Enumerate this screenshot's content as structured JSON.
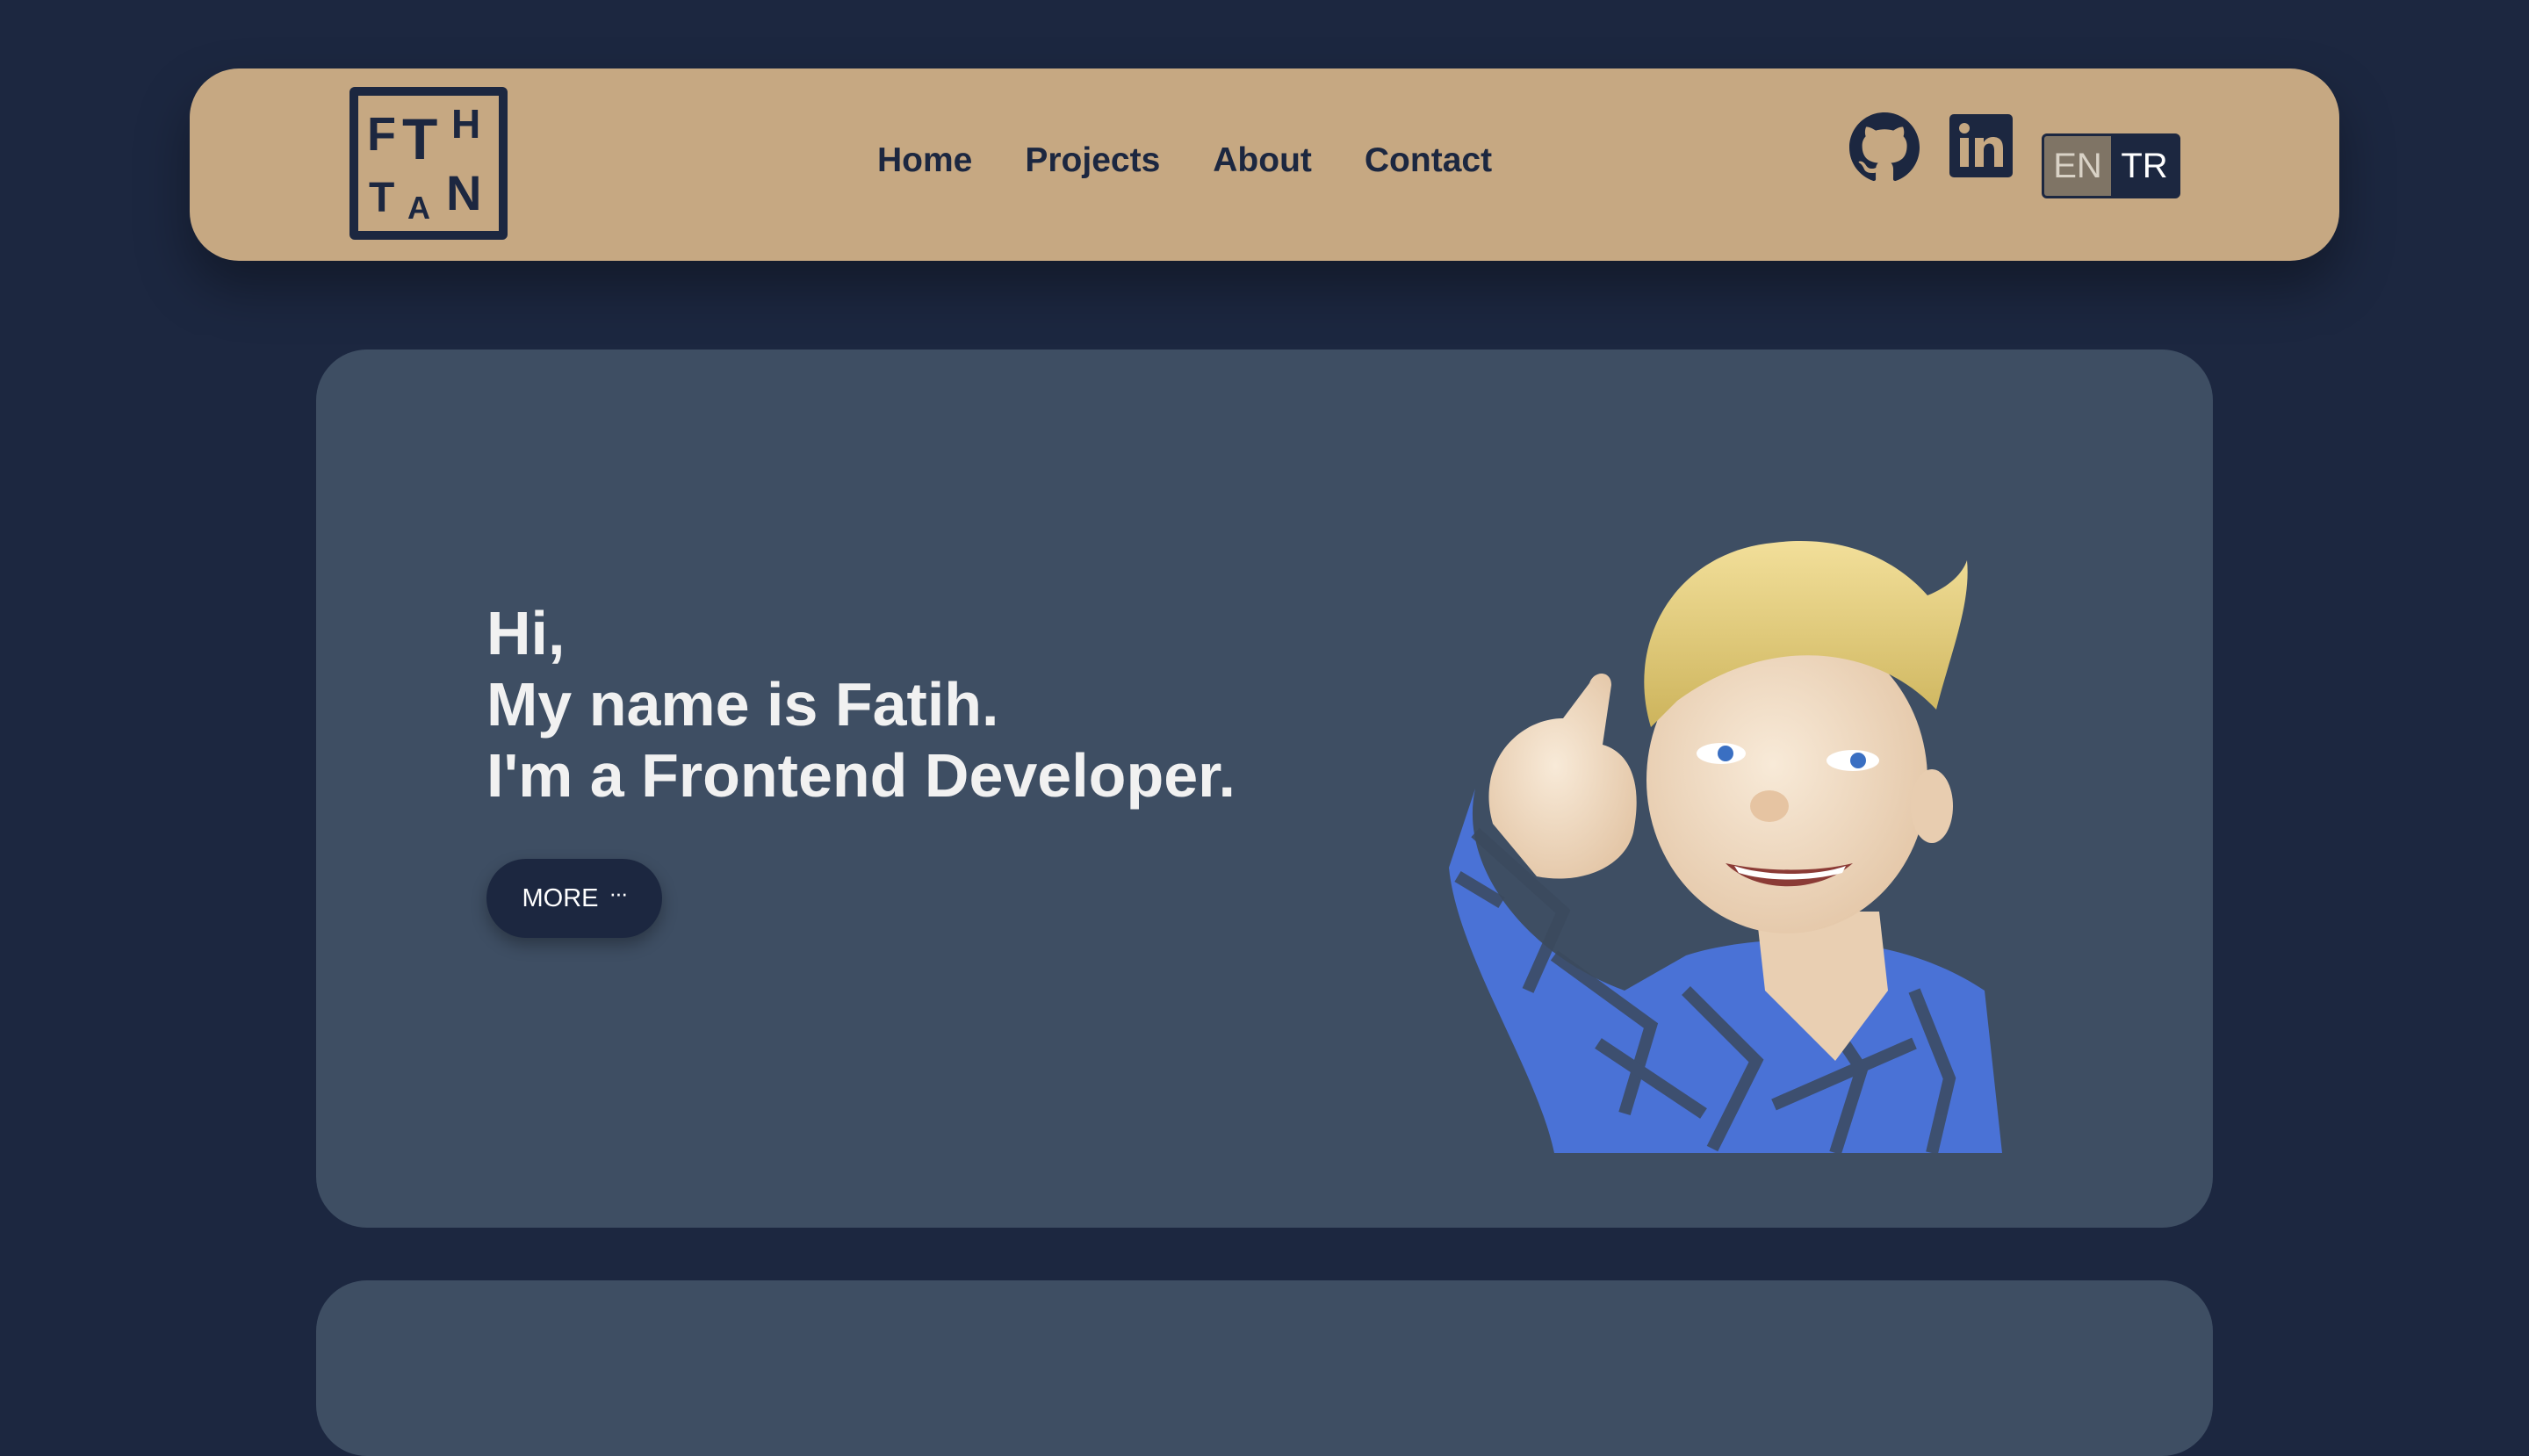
{
  "logo": {
    "letters": [
      "F",
      "T",
      "H",
      "T",
      "A",
      "N"
    ]
  },
  "nav": {
    "links": [
      {
        "label": "Home"
      },
      {
        "label": "Projects"
      },
      {
        "label": "About"
      },
      {
        "label": "Contact"
      }
    ]
  },
  "social": {
    "icons": [
      "github-icon",
      "linkedin-icon"
    ]
  },
  "language": {
    "options": [
      "EN",
      "TR"
    ]
  },
  "hero": {
    "line1": "Hi,",
    "line2": "My name is Fatih.",
    "line3": "I'm a Frontend Developer.",
    "more_label": "MORE",
    "more_icon": "···"
  },
  "colors": {
    "page_bg": "#1c2740",
    "nav_bg": "#c6a882",
    "card_bg": "#3e4e63",
    "text_dark": "#1c2740",
    "text_light": "#f1f1f1"
  }
}
